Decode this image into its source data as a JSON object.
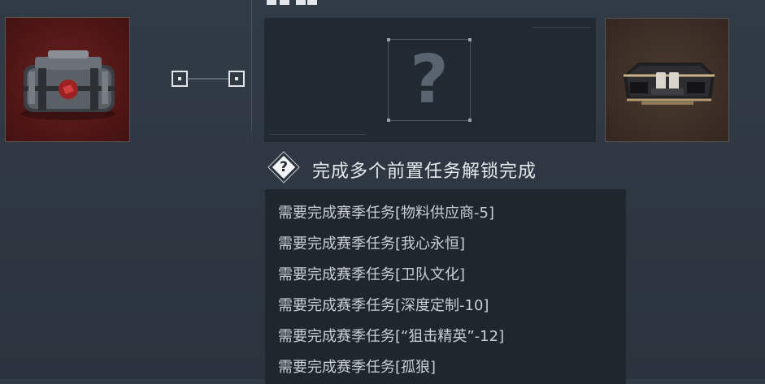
{
  "unlock": {
    "title": "完成多个前置任务解锁完成",
    "icon": "question-diamond-icon"
  },
  "preview": {
    "placeholder": "?"
  },
  "tasks": [
    "需要完成赛季任务[物料供应商-5]",
    "需要完成赛季任务[我心永恒]",
    "需要完成赛季任务[卫队文化]",
    "需要完成赛季任务[深度定制-10]",
    "需要完成赛季任务[“狙击精英”-12]",
    "需要完成赛季任务[孤狼]"
  ],
  "colors": {
    "background": "#2f3944",
    "panel": "#1f262e",
    "red_card": "#4e1515",
    "brown_card": "#3b2d25"
  }
}
